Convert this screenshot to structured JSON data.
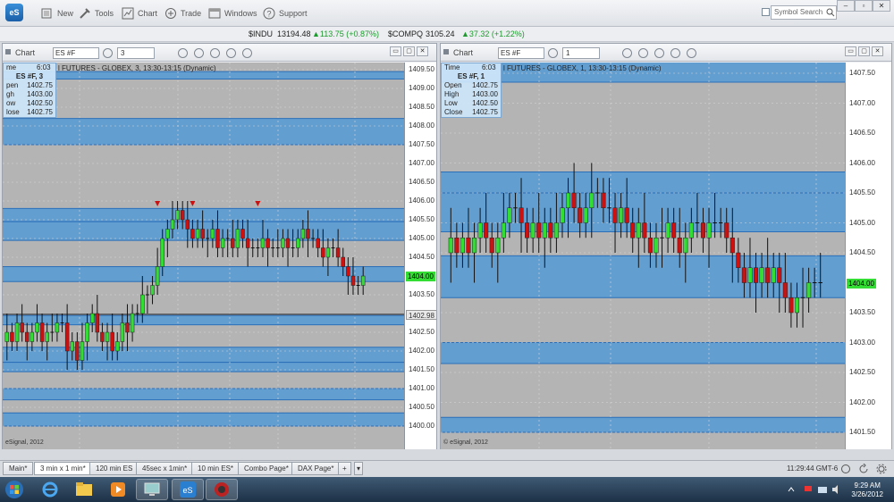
{
  "toolbar": {
    "logo": "eS",
    "items": [
      "New",
      "Tools",
      "Chart",
      "Trade",
      "Windows",
      "Support"
    ],
    "search_placeholder": "Symbol Search"
  },
  "ticker": {
    "indu_symbol": "$INDU",
    "indu_value": "13194.48",
    "indu_change": "▲113.75 (+0.87%)",
    "compq_symbol": "$COMPQ",
    "compq_value": "3105.24",
    "compq_change": "▲37.32 (+1.22%)"
  },
  "left_chart": {
    "title": "Chart",
    "symbol": "ES #F",
    "interval": "3",
    "description": "l FUTURES - GLOBEX, 3, 13:30-13:15 (Dynamic)",
    "info_header": "ES #F, 3",
    "info": [
      {
        "label": "me",
        "value": "6:03"
      },
      {
        "label": "pen",
        "value": "1402.75"
      },
      {
        "label": "gh",
        "value": "1403.00"
      },
      {
        "label": "ow",
        "value": "1402.50"
      },
      {
        "label": "lose",
        "value": "1402.75"
      }
    ],
    "ticks": [
      "1409.50",
      "1409.00",
      "1408.50",
      "1408.00",
      "1407.50",
      "1407.00",
      "1406.50",
      "1406.00",
      "1405.50",
      "1405.00",
      "1404.50",
      "1403.50",
      "1402.50",
      "1402.00",
      "1401.50",
      "1401.00",
      "1400.50",
      "1400.00"
    ],
    "current_price": "1404.00",
    "line_price": "1402.98",
    "copyright": "eSignal, 2012"
  },
  "right_chart": {
    "title": "Chart",
    "symbol": "ES #F",
    "interval": "1",
    "description": "l FUTURES - GLOBEX, 1, 13:30-13:15 (Dynamic)",
    "info_header": "ES #F, 1",
    "info": [
      {
        "label": "Time",
        "value": "6:03"
      },
      {
        "label": "Open",
        "value": "1402.75"
      },
      {
        "label": "High",
        "value": "1403.00"
      },
      {
        "label": "Low",
        "value": "1402.50"
      },
      {
        "label": "Close",
        "value": "1402.75"
      }
    ],
    "ticks": [
      "1407.50",
      "1407.00",
      "1406.50",
      "1406.00",
      "1405.50",
      "1405.00",
      "1404.50",
      "1403.50",
      "1403.00",
      "1402.50",
      "1402.00",
      "1401.50"
    ],
    "current_price": "1404.00",
    "copyright": "© eSignal, 2012"
  },
  "tabs": [
    "Main*",
    "3 min x 1 min*",
    "120 min ES",
    "45sec x 1min*",
    "10 min ES*",
    "Combo Page*",
    "DAX Page*"
  ],
  "active_tab": "3 min x 1 min*",
  "status_clock": "11:29:44 GMT-6",
  "taskbar": {
    "time": "9:29 AM",
    "date": "3/26/2012",
    "apps": [
      "Windows Explorer",
      "Internet Explorer",
      "Folder",
      "Media Player",
      "Computer",
      "eSignal",
      "Browser"
    ]
  },
  "colors": {
    "bull_candle": "#33dd33",
    "bear_candle": "#cc1111",
    "band": "#5a9bd4",
    "chart_bg": "#b4b4b4",
    "price_tag": "#33dd33"
  }
}
